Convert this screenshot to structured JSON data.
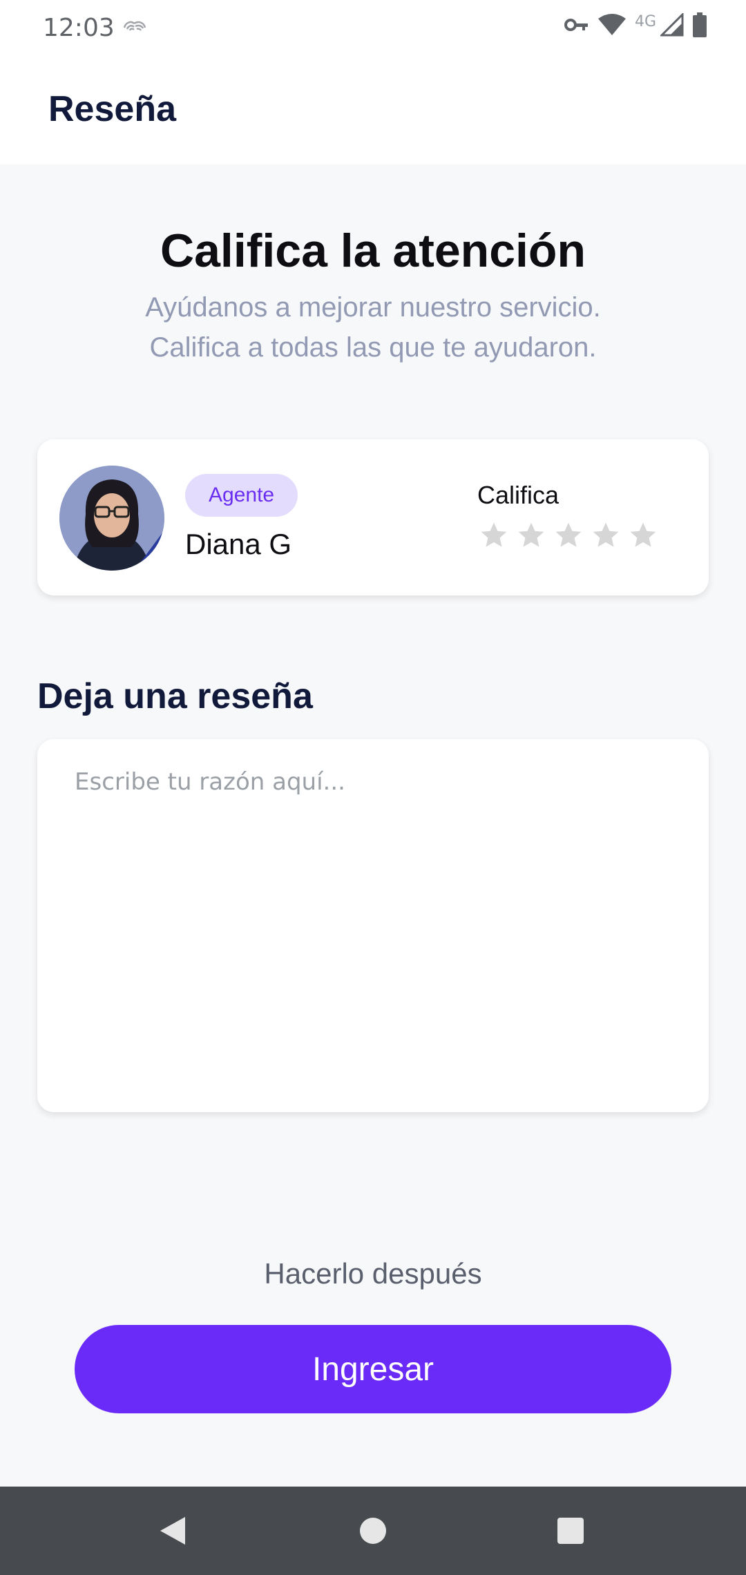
{
  "status_bar": {
    "time": "12:03",
    "network_label": "4G",
    "icons": [
      "nfc-icon",
      "vpn-key-icon",
      "wifi-icon",
      "cell-signal-icon",
      "battery-icon"
    ]
  },
  "app_bar": {
    "title": "Reseña"
  },
  "header": {
    "headline": "Califica la atención",
    "subtitle": "Ayúdanos a mejorar nuestro servicio.\nCalifica a todas las que te ayudaron."
  },
  "agent": {
    "badge": "Agente",
    "name": "Diana G",
    "rate_label": "Califica",
    "rating": 0,
    "max_rating": 5
  },
  "review": {
    "title": "Deja una reseña",
    "placeholder": "Escribe tu razón aquí...",
    "value": ""
  },
  "actions": {
    "later_label": "Hacerlo después",
    "submit_label": "Ingresar"
  },
  "colors": {
    "accent": "#6A2AF8",
    "badge_bg": "#E4DCFC",
    "star_inactive": "#D6D6D6",
    "title_dark": "#111A3A"
  },
  "nav_bar": {
    "icons": [
      "back-icon",
      "home-icon",
      "recents-icon"
    ]
  }
}
